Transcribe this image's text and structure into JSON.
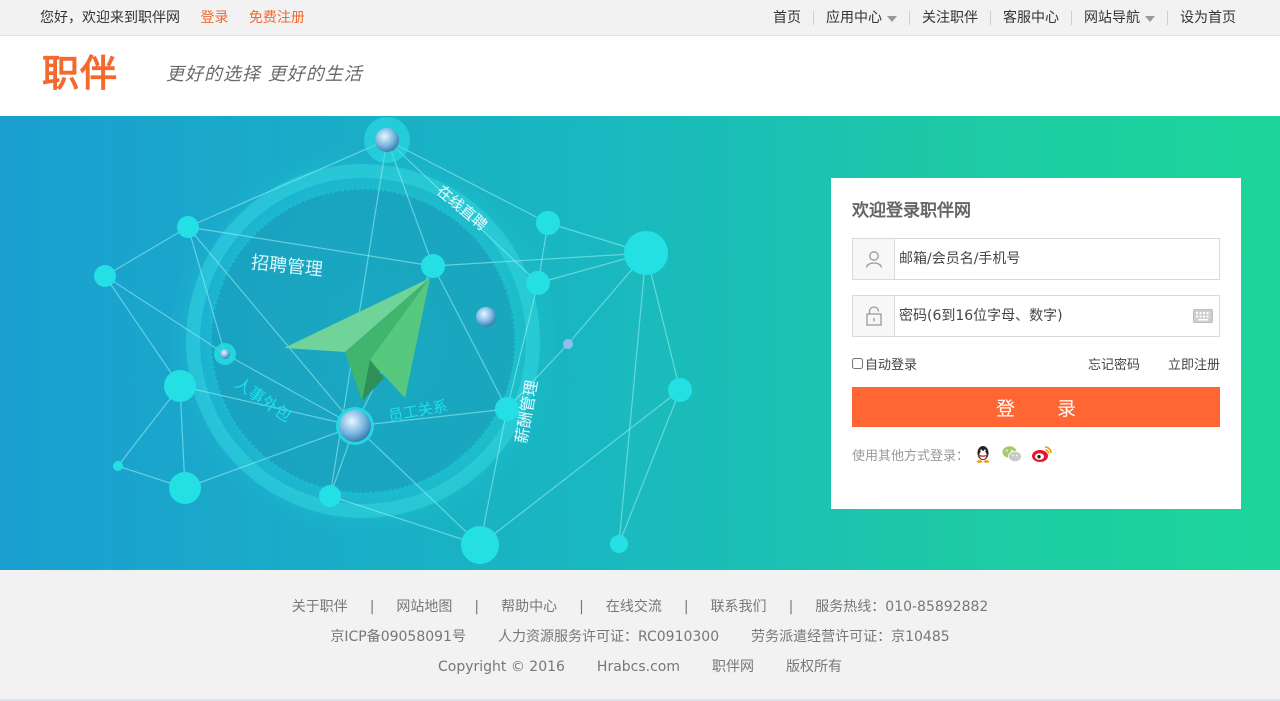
{
  "topbar": {
    "welcome": "您好，欢迎来到职伴网",
    "login": "登录",
    "register": "免费注册",
    "nav": [
      {
        "label": "首页",
        "dropdown": false
      },
      {
        "label": "应用中心",
        "dropdown": true
      },
      {
        "label": "关注职伴",
        "dropdown": false
      },
      {
        "label": "客服中心",
        "dropdown": false
      },
      {
        "label": "网站导航",
        "dropdown": true
      },
      {
        "label": "设为首页",
        "dropdown": false
      }
    ]
  },
  "header": {
    "logo": "职伴",
    "slogan": "更好的选择 更好的生活"
  },
  "banner": {
    "labels": [
      "招聘管理",
      "在线直聘",
      "人事外包",
      "员工关系",
      "薪酬管理"
    ]
  },
  "login": {
    "title": "欢迎登录职伴网",
    "username_placeholder": "邮箱/会员名/手机号",
    "password_placeholder": "密码(6到16位字母、数字)",
    "auto_login": "自动登录",
    "forgot": "忘记密码",
    "register": "立即注册",
    "submit": "登  录",
    "other_login": "使用其他方式登录："
  },
  "footer": {
    "links": [
      "关于职伴",
      "网站地图",
      "帮助中心",
      "在线交流",
      "联系我们"
    ],
    "hotline": "服务热线：010-85892882",
    "licenses": [
      "京ICP备09058091号",
      "人力资源服务许可证：RC0910300",
      "劳务派遣经营许可证：京10485"
    ],
    "copyright": [
      "Copyright © 2016",
      "Hrabcs.com",
      "职伴网",
      "版权所有"
    ]
  },
  "colors": {
    "accent": "#f26a2e",
    "button": "#ff6633",
    "banner_from": "#1a9fd0",
    "banner_to": "#1dd59a"
  }
}
